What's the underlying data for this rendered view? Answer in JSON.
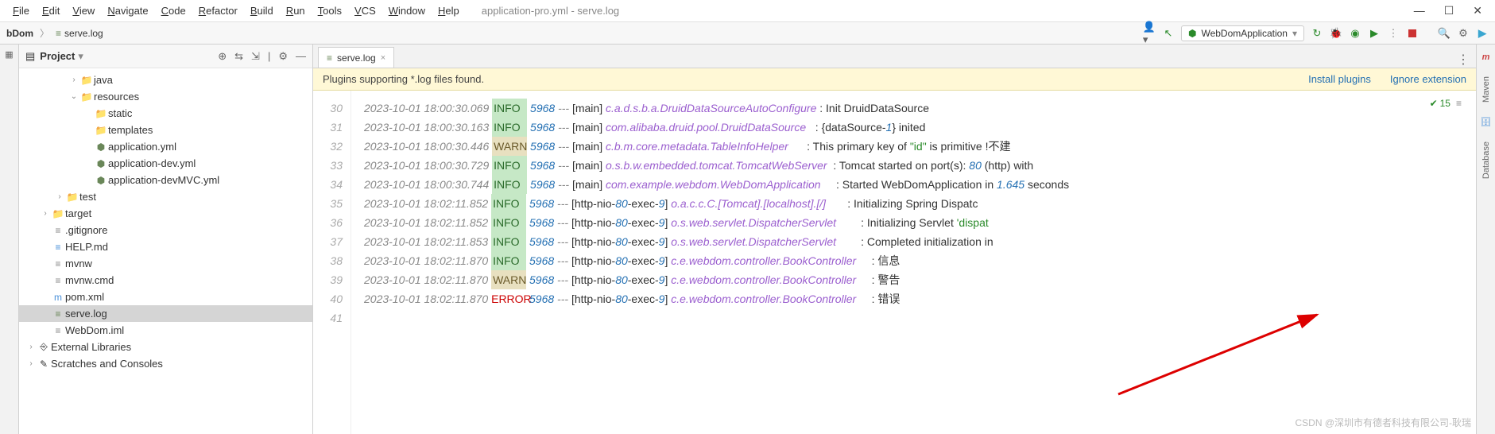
{
  "menu": {
    "items": [
      "File",
      "Edit",
      "View",
      "Navigate",
      "Code",
      "Refactor",
      "Build",
      "Run",
      "Tools",
      "VCS",
      "Window",
      "Help"
    ],
    "title": "application-pro.yml - serve.log"
  },
  "breadcrumb": {
    "root": "bDom",
    "file": "serve.log"
  },
  "runConfig": {
    "label": "WebDomApplication"
  },
  "projectHeader": {
    "title": "Project"
  },
  "tree": [
    {
      "depth": 3,
      "exp": ">",
      "icon": "folder",
      "label": "java"
    },
    {
      "depth": 3,
      "exp": "v",
      "icon": "folder-gray",
      "label": "resources"
    },
    {
      "depth": 4,
      "exp": "",
      "icon": "folder-gray",
      "label": "static"
    },
    {
      "depth": 4,
      "exp": "",
      "icon": "folder-gray",
      "label": "templates"
    },
    {
      "depth": 4,
      "exp": "",
      "icon": "file-yml",
      "label": "application.yml"
    },
    {
      "depth": 4,
      "exp": "",
      "icon": "file-yml",
      "label": "application-dev.yml"
    },
    {
      "depth": 4,
      "exp": "",
      "icon": "file-yml",
      "label": "application-devMVC.yml"
    },
    {
      "depth": 2,
      "exp": ">",
      "icon": "folder-gray",
      "label": "test"
    },
    {
      "depth": 1,
      "exp": ">",
      "icon": "folder-orange",
      "label": "target"
    },
    {
      "depth": 1,
      "exp": "",
      "icon": "file-generic",
      "label": ".gitignore"
    },
    {
      "depth": 1,
      "exp": "",
      "icon": "file-md",
      "label": "HELP.md"
    },
    {
      "depth": 1,
      "exp": "",
      "icon": "file-generic",
      "label": "mvnw"
    },
    {
      "depth": 1,
      "exp": "",
      "icon": "file-generic",
      "label": "mvnw.cmd"
    },
    {
      "depth": 1,
      "exp": "",
      "icon": "file-xml",
      "label": "pom.xml"
    },
    {
      "depth": 1,
      "exp": "",
      "icon": "file-txt",
      "label": "serve.log",
      "selected": true
    },
    {
      "depth": 1,
      "exp": "",
      "icon": "file-generic",
      "label": "WebDom.iml"
    },
    {
      "depth": 0,
      "exp": ">",
      "icon": "lib",
      "label": "External Libraries"
    },
    {
      "depth": 0,
      "exp": ">",
      "icon": "scratch",
      "label": "Scratches and Consoles"
    }
  ],
  "editorTab": {
    "label": "serve.log"
  },
  "banner": {
    "text": "Plugins supporting *.log files found.",
    "install": "Install plugins",
    "ignore": "Ignore extension"
  },
  "inspect": {
    "count": "15"
  },
  "gutterStart": 29,
  "log": [
    {
      "n": 30,
      "ts": "2023-10-01 18:00:30.069",
      "lvl": "INFO",
      "pid": "5968",
      "thread": "[main]",
      "logger": "c.a.d.s.b.a.DruidDataSourceAutoConfigure",
      "msg": "Init DruidDataSource"
    },
    {
      "n": 31,
      "ts": "2023-10-01 18:00:30.163",
      "lvl": "INFO",
      "pid": "5968",
      "thread": "[main]",
      "logger": "com.alibaba.druid.pool.DruidDataSource",
      "msg": "{dataSource-<n>1</n>} inited"
    },
    {
      "n": 32,
      "ts": "2023-10-01 18:00:30.446",
      "lvl": "WARN",
      "pid": "5968",
      "thread": "[main]",
      "logger": "c.b.m.core.metadata.TableInfoHelper",
      "msg": "This primary key of <s>\"id\"</s> is primitive !不建"
    },
    {
      "n": 33,
      "ts": "2023-10-01 18:00:30.729",
      "lvl": "INFO",
      "pid": "5968",
      "thread": "[main]",
      "logger": "o.s.b.w.embedded.tomcat.TomcatWebServer",
      "msg": "Tomcat started on port(s): <n>80</n> (http) with "
    },
    {
      "n": 34,
      "ts": "2023-10-01 18:00:30.744",
      "lvl": "INFO",
      "pid": "5968",
      "thread": "[main]",
      "logger": "com.example.webdom.WebDomApplication",
      "msg": "Started WebDomApplication in <n>1.645</n> seconds"
    },
    {
      "n": 35,
      "ts": "2023-10-01 18:02:11.852",
      "lvl": "INFO",
      "pid": "5968",
      "thread": "[http-nio-<n>80</n>-exec-<n>9</n>]",
      "logger": "o.a.c.c.C.[Tomcat].[localhost].[/]",
      "msg": "Initializing Spring Dispatc"
    },
    {
      "n": 36,
      "ts": "2023-10-01 18:02:11.852",
      "lvl": "INFO",
      "pid": "5968",
      "thread": "[http-nio-<n>80</n>-exec-<n>9</n>]",
      "logger": "o.s.web.servlet.DispatcherServlet",
      "msg": "Initializing Servlet <s>'dispat</s>"
    },
    {
      "n": 37,
      "ts": "2023-10-01 18:02:11.853",
      "lvl": "INFO",
      "pid": "5968",
      "thread": "[http-nio-<n>80</n>-exec-<n>9</n>]",
      "logger": "o.s.web.servlet.DispatcherServlet",
      "msg": "Completed initialization in "
    },
    {
      "n": 38,
      "ts": "2023-10-01 18:02:11.870",
      "lvl": "INFO",
      "pid": "5968",
      "thread": "[http-nio-<n>80</n>-exec-<n>9</n>]",
      "logger": "c.e.webdom.controller.BookController",
      "msg": "信息"
    },
    {
      "n": 39,
      "ts": "2023-10-01 18:02:11.870",
      "lvl": "WARN",
      "pid": "5968",
      "thread": "[http-nio-<n>80</n>-exec-<n>9</n>]",
      "logger": "c.e.webdom.controller.BookController",
      "msg": "警告"
    },
    {
      "n": 40,
      "ts": "2023-10-01 18:02:11.870",
      "lvl": "ERROR",
      "pid": "5968",
      "thread": "[http-nio-<n>80</n>-exec-<n>9</n>]",
      "logger": "c.e.webdom.controller.BookController",
      "msg": "错误"
    }
  ],
  "rightBar": {
    "maven": "Maven",
    "database": "Database"
  },
  "watermark": "CSDN @深圳市有德者科技有限公司-耿瑞"
}
